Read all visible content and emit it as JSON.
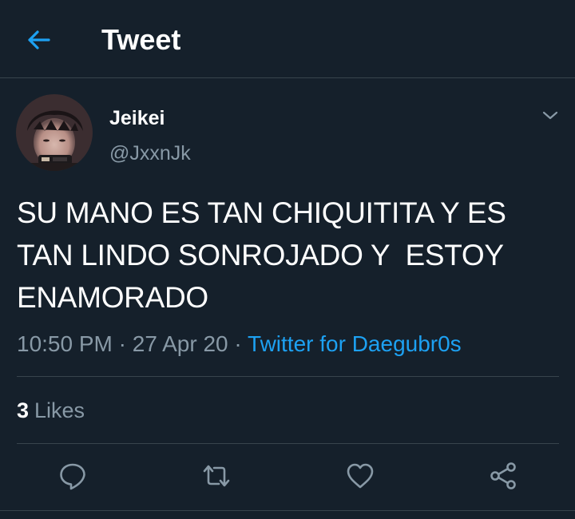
{
  "header": {
    "title": "Tweet",
    "back_icon": "arrow-left-icon",
    "accent_color": "#1da1f2"
  },
  "tweet": {
    "author": {
      "display_name": "Jeikei",
      "handle": "@JxxnJk"
    },
    "text_lines": [
      "SU MANO ES TAN CHIQUITITA Y ES",
      "TAN LINDO SONROJADO Y  ESTOY",
      "ENAMORADO"
    ],
    "time": "10:50 PM",
    "separator": "·",
    "date": "27 Apr 20",
    "source": "Twitter for Daegubr0s",
    "likes_count": "3",
    "likes_label": "Likes"
  },
  "actions": [
    {
      "name": "reply",
      "icon": "reply-icon"
    },
    {
      "name": "retweet",
      "icon": "retweet-icon"
    },
    {
      "name": "like",
      "icon": "heart-icon"
    },
    {
      "name": "share",
      "icon": "share-icon"
    }
  ],
  "colors": {
    "background": "#15202b",
    "border": "#38444d",
    "secondary_text": "#8899a6",
    "link": "#1da1f2"
  }
}
